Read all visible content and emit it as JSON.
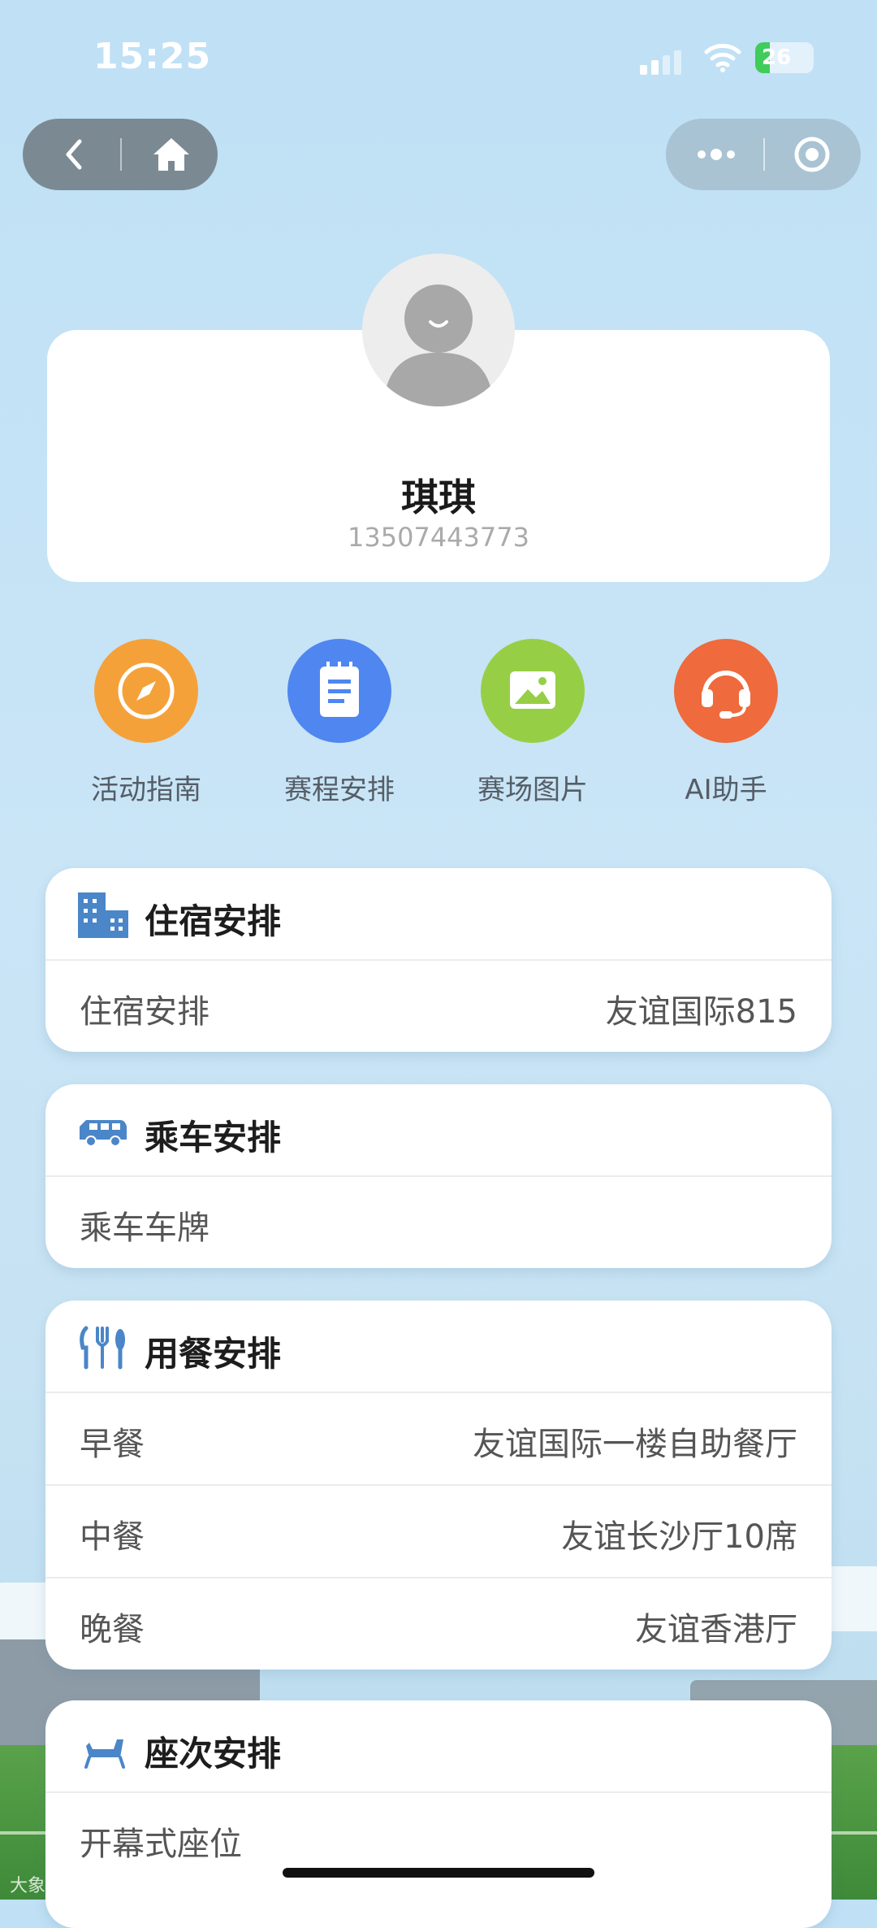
{
  "status": {
    "time": "15:25",
    "battery": "26"
  },
  "profile": {
    "name": "琪琪",
    "phone": "13507443773"
  },
  "quick_actions": [
    {
      "label": "活动指南",
      "icon": "compass-icon",
      "color": "#f5a13a"
    },
    {
      "label": "赛程安排",
      "icon": "notepad-icon",
      "color": "#4f86f0"
    },
    {
      "label": "赛场图片",
      "icon": "image-icon",
      "color": "#96cf45"
    },
    {
      "label": "AI助手",
      "icon": "headset-icon",
      "color": "#ef6a3c"
    }
  ],
  "sections": {
    "lodging": {
      "title": "住宿安排",
      "icon": "building-icon",
      "rows": [
        {
          "label": "住宿安排",
          "value": "友谊国际815"
        }
      ]
    },
    "transport": {
      "title": "乘车安排",
      "icon": "van-icon",
      "rows": [
        {
          "label": "乘车车牌",
          "value": ""
        }
      ]
    },
    "dining": {
      "title": "用餐安排",
      "icon": "utensils-icon",
      "rows": [
        {
          "label": "早餐",
          "value": "友谊国际一楼自助餐厅"
        },
        {
          "label": "中餐",
          "value": "友谊长沙厅10席"
        },
        {
          "label": "晚餐",
          "value": "友谊香港厅"
        }
      ]
    },
    "seating": {
      "title": "座次安排",
      "icon": "seat-icon",
      "rows": [
        {
          "label": "开幕式座位",
          "value": ""
        }
      ]
    }
  },
  "watermark": "大象跨境",
  "accent": "#4a86c8"
}
